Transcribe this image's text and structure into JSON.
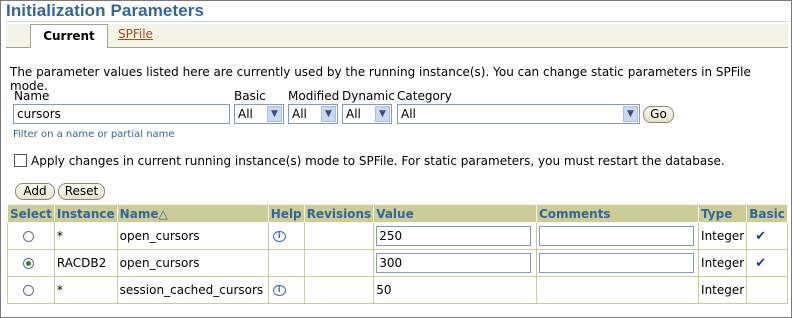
{
  "header": {
    "title": "Initialization Parameters"
  },
  "tabs": [
    {
      "label": "Current",
      "active": true
    },
    {
      "label": "SPFile",
      "active": false
    }
  ],
  "description": "The parameter values listed here are currently used by the running instance(s).  You can change static parameters in SPFile mode.",
  "filters": {
    "name_label": "Name",
    "name_value": "cursors",
    "name_hint": "Filter on a name or partial name",
    "basic_label": "Basic",
    "basic_value": "All",
    "modified_label": "Modified",
    "modified_value": "All",
    "dynamic_label": "Dynamic",
    "dynamic_value": "All",
    "category_label": "Category",
    "category_value": "All",
    "go_label": "Go"
  },
  "apply_spfile": {
    "checked": false,
    "label": "Apply changes in current running instance(s) mode to SPFile. For static parameters, you must restart the database."
  },
  "actions": {
    "add_label": "Add",
    "reset_label": "Reset"
  },
  "table": {
    "columns": [
      "Select",
      "Instance",
      "Name△",
      "Help",
      "Revisions",
      "Value",
      "Comments",
      "Type",
      "Basic"
    ],
    "rows": [
      {
        "selected": false,
        "instance": "*",
        "name": "open_cursors",
        "help": true,
        "revisions": "",
        "value": "250",
        "value_editable": true,
        "comments": "",
        "type": "Integer",
        "basic": true
      },
      {
        "selected": true,
        "instance": "RACDB2",
        "name": "open_cursors",
        "help": false,
        "revisions": "",
        "value": "300",
        "value_editable": true,
        "comments": "",
        "type": "Integer",
        "basic": true
      },
      {
        "selected": false,
        "instance": "*",
        "name": "session_cached_cursors",
        "help": true,
        "revisions": "",
        "value": "50",
        "value_editable": false,
        "comments": "",
        "type": "Integer",
        "basic": false
      }
    ]
  },
  "colors": {
    "title": "#336699",
    "header_bg": "#cccc99",
    "tab_link": "#99501d"
  }
}
